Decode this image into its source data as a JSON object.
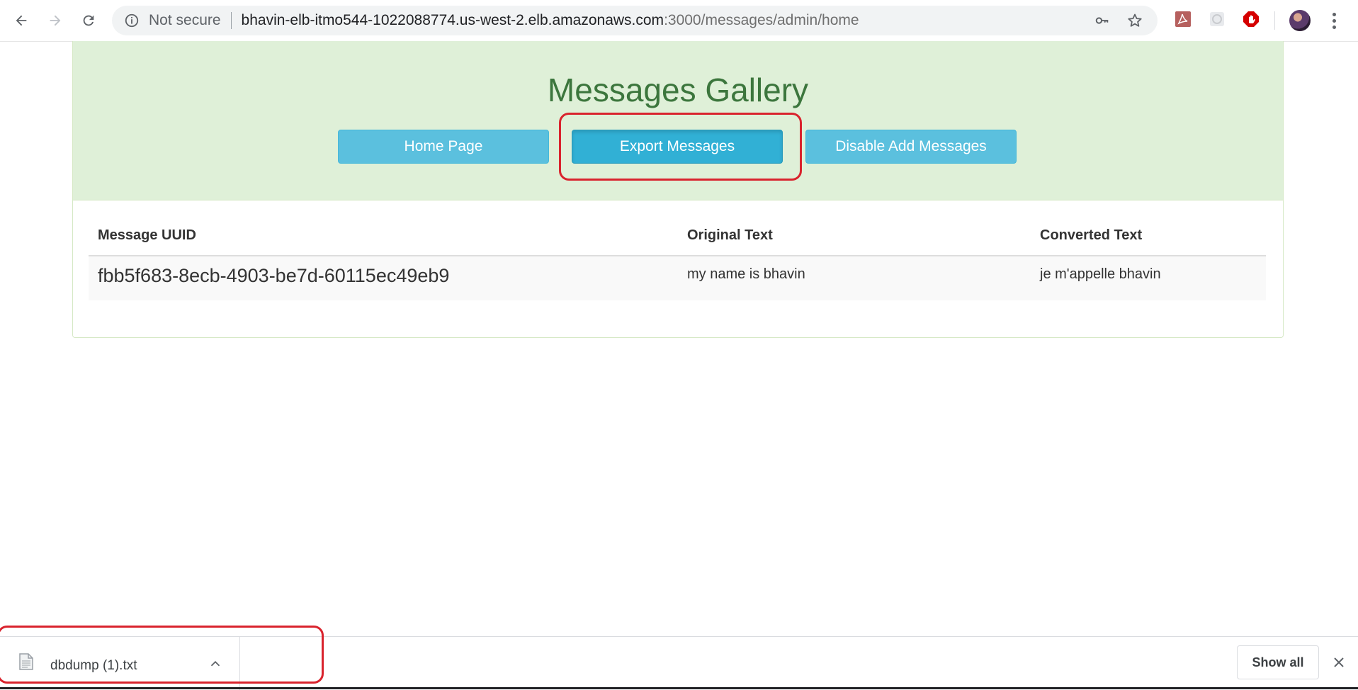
{
  "browser": {
    "security_label": "Not secure",
    "url_host": "bhavin-elb-itmo544-1022088774.us-west-2.elb.amazonaws.com",
    "url_path": ":3000/messages/admin/home",
    "icons": {
      "back": "arrow-left-icon",
      "forward": "arrow-right-icon",
      "reload": "reload-icon",
      "info": "info-icon",
      "key": "key-icon",
      "star": "star-icon",
      "ext_pdf": "acrobat-extension-icon",
      "ext_gray": "extension-icon",
      "ext_block": "adblock-icon",
      "menu": "more-vertical-icon"
    }
  },
  "page": {
    "title": "Messages Gallery",
    "buttons": {
      "home": "Home Page",
      "export": "Export Messages",
      "disable_add": "Disable Add Messages"
    },
    "colors": {
      "heading_bg": "#dff0d8",
      "title_color": "#3c763d",
      "button_bg": "#5bc0de",
      "annotation": "#d9232d"
    },
    "table": {
      "headers": {
        "uuid": "Message UUID",
        "original": "Original Text",
        "converted": "Converted Text"
      },
      "rows": [
        {
          "uuid": "fbb5f683-8ecb-4903-be7d-60115ec49eb9",
          "original": "my name is bhavin",
          "converted": "je m'appelle bhavin"
        }
      ]
    }
  },
  "downloads": {
    "file_name": "dbdump (1).txt",
    "show_all": "Show all"
  }
}
